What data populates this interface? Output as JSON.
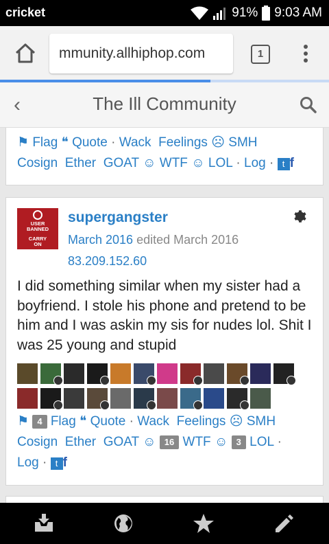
{
  "status_bar": {
    "carrier": "cricket",
    "battery": "91%",
    "time": "9:03 AM"
  },
  "browser": {
    "url": "mmunity.allhiphop.com",
    "tab_count": "1",
    "load_progress": 0.64
  },
  "site": {
    "title": "The Ill Community"
  },
  "prev_post": {
    "reactions_line1": [
      "Flag",
      "Quote",
      "Wack",
      "Feelings",
      "SMH"
    ],
    "reactions_line2": [
      "Cosign",
      "Ether",
      "GOAT",
      "WTF",
      "LOL",
      "Log"
    ]
  },
  "post": {
    "avatar_text": [
      "USER",
      "BANNED",
      "CARRY",
      "ON"
    ],
    "username": "supergangster",
    "date": "March 2016",
    "edited": "edited March 2016",
    "ip": "83.209.152.60",
    "body": "I did something similar when my sister had a boyfriend. I stole his phone and pretend to be him and I was askin my sis for nudes lol. Shit I was 25 young and stupid",
    "flag_count": "4",
    "goat_count": "16",
    "lol_count": "3",
    "reactions": {
      "flag": "Flag",
      "quote": "Quote",
      "wack": "Wack",
      "feelings": "Feelings",
      "smh": "SMH",
      "cosign": "Cosign",
      "ether": "Ether",
      "goat": "GOAT",
      "wtf": "WTF",
      "lol": "LOL",
      "log": "Log"
    },
    "reactor_colors_row1": [
      "#5a4a2a",
      "#3a6a3a",
      "#2a2a2a",
      "#1a1a1a",
      "#c87a2a",
      "#3a4a6a",
      "#d03a8a",
      "#8a2a2a",
      "#4a4a4a",
      "#6a4a2a",
      "#2a2a5a",
      "#222222"
    ],
    "reactor_colors_row2": [
      "#8a2a2a",
      "#1a1a1a",
      "#3a3a3a",
      "#5a4a3a",
      "#6a6a6a",
      "#2a3a4a",
      "#7a4a4a",
      "#3a6a8a",
      "#2a4a8a",
      "#2a2a2a",
      "#4a5a4a"
    ]
  },
  "colors": {
    "link": "#2a7fc6",
    "status_bar": "#000000",
    "nav_bar": "#000000"
  }
}
